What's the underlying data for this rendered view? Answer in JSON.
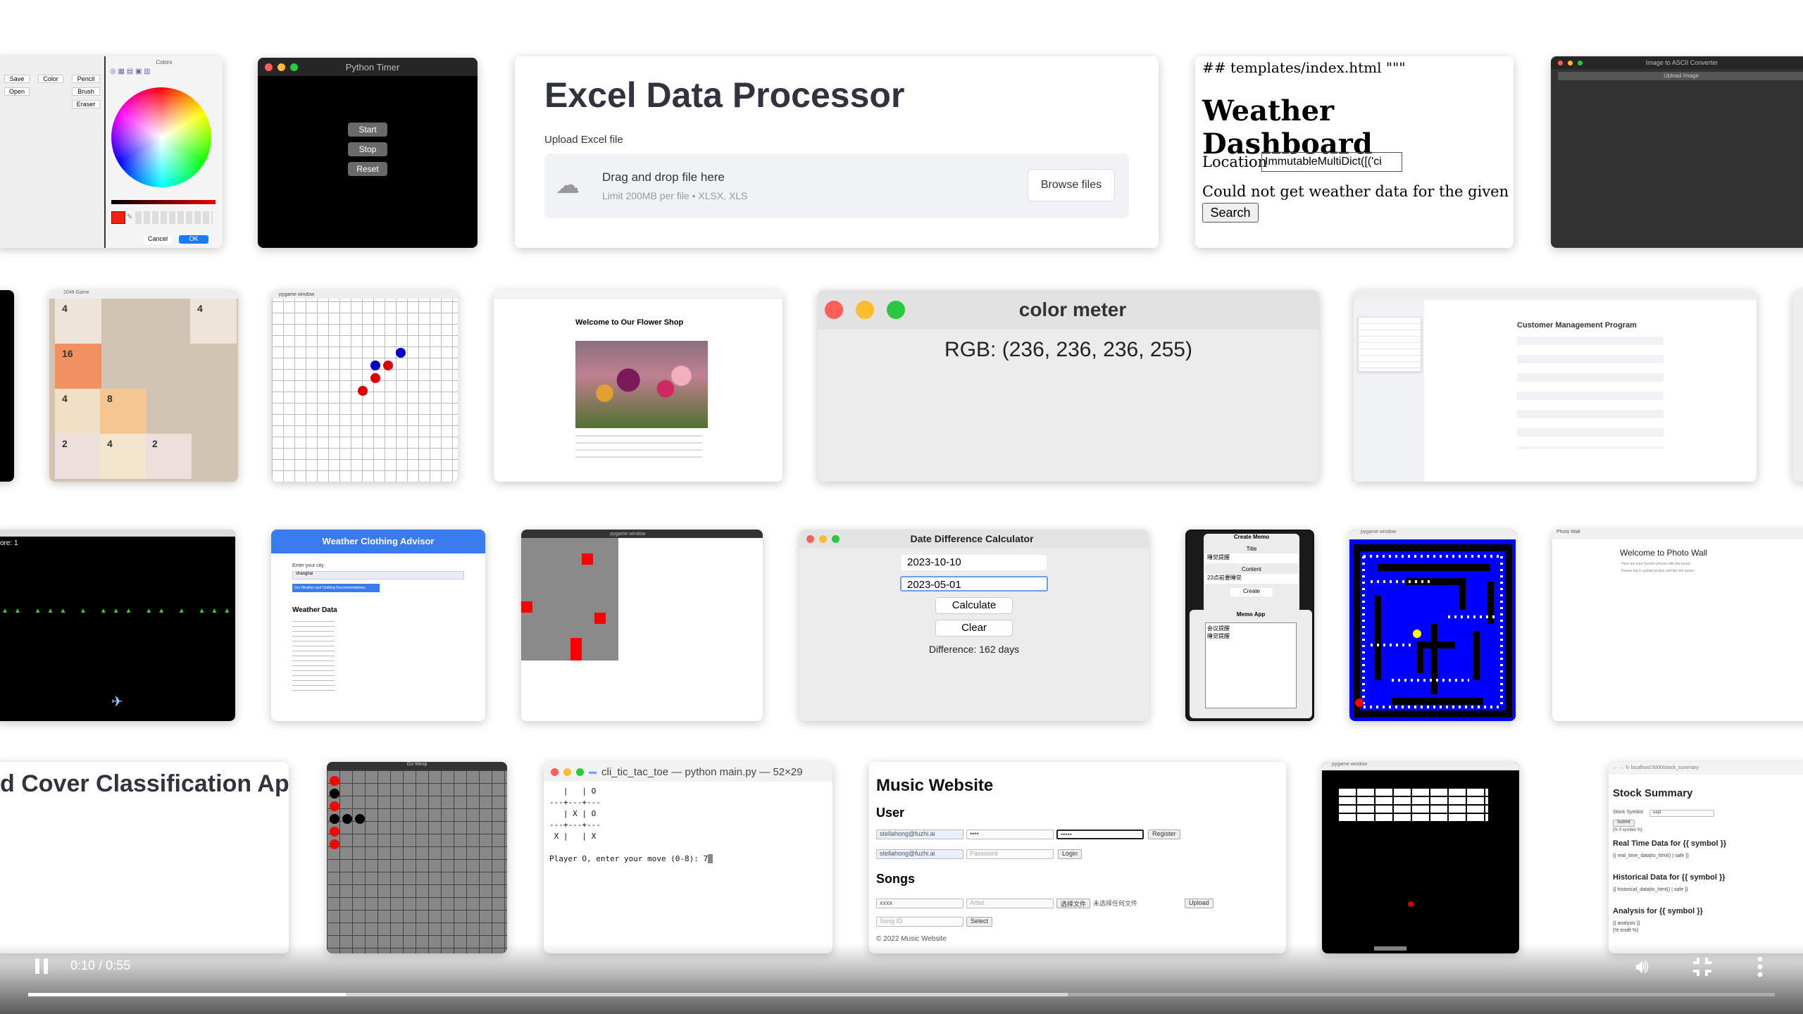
{
  "colors_app": {
    "save": "Save",
    "color": "Color",
    "pencil": "Pencil",
    "open": "Open",
    "brush": "Brush",
    "eraser": "Eraser",
    "dialog_title": "Colors",
    "cancel": "Cancel",
    "ok": "OK"
  },
  "timer_app": {
    "title": "Python Timer",
    "start": "Start",
    "stop": "Stop",
    "reset": "Reset"
  },
  "excel_app": {
    "title": "Excel Data Processor",
    "upload_label": "Upload Excel file",
    "drag_text": "Drag and drop file here",
    "limit_text": "Limit 200MB per file • XLSX, XLS",
    "browse_button": "Browse files"
  },
  "weather_app": {
    "header_comment": "## templates/index.html \"\"\"",
    "title": "Weather Dashboard",
    "location_label": "Location",
    "location_value": "ImmutableMultiDict([('ci",
    "message": "Could not get weather data for the given location.",
    "search_button": "Search"
  },
  "ascii_app": {
    "title": "Image to ASCII Converter",
    "upload_button": "Upload Image"
  },
  "game2048": {
    "cells": [
      "4",
      "4",
      "16",
      "4",
      "8",
      "2",
      "4",
      "2"
    ]
  },
  "pygame_grid": {
    "title": "pygame window"
  },
  "flower_shop": {
    "heading": "Welcome to Our Flower Shop"
  },
  "color_meter": {
    "title": "color meter",
    "rgb_text": "RGB: (236, 236, 236, 255)"
  },
  "customer_app": {
    "title": "Customer Management Program"
  },
  "space_game": {
    "score": "ore: 1"
  },
  "clothing_app": {
    "title": "Weather Clothing Advisor",
    "city_label": "Enter your city",
    "city_value": "shanghai",
    "get_button": "Get Weather and Clothing Recommendations",
    "weather_heading": "Weather Data"
  },
  "pygame_red": {
    "title": "pygame window"
  },
  "date_calc": {
    "title": "Date Difference Calculator",
    "date1": "2023-10-10",
    "date2": "2023-05-01",
    "calculate": "Calculate",
    "clear": "Clear",
    "result": "Difference: 162 days"
  },
  "memo_app": {
    "create_title": "Create Memo",
    "title_label": "Title",
    "title_value": "睡觉提醒",
    "content_label": "Content",
    "content_value": "23点前要睡觉",
    "create_button": "Create",
    "list_title": "Memo App",
    "list_items": [
      "会议提醒",
      "睡觉提醒"
    ]
  },
  "pacman": {
    "title": "pygame window"
  },
  "photo_wall": {
    "tab": "Photo Wall",
    "heading": "Welcome to Photo Wall",
    "sub1": "Here are your favorite photos with the tunes!",
    "sub2": "Please log in upload photos and like the tunes!"
  },
  "cover_app": {
    "title_partial": "d Cover Classification App"
  },
  "go_game": {
    "title": "Go Weiqi"
  },
  "terminal": {
    "title": "cli_tic_tac_toe — python main.py — 52×29",
    "board": [
      "   |   | O",
      "---+---+---",
      "   | X | O",
      "---+---+---",
      " X |   | X"
    ],
    "prompt": "Player O, enter your move (0-8): 7"
  },
  "music_app": {
    "title": "Music Website",
    "user_heading": "User",
    "email1": "stellahong@fuzhi.ai",
    "pw1": "••••",
    "pw_confirm": "•••••",
    "register": "Register",
    "email2": "stellahong@fuzhi.ai",
    "pw2": "Password",
    "login": "Login",
    "songs_heading": "Songs",
    "song_title": "xxxx",
    "artist": "Artist",
    "choose_file": "选择文件",
    "no_file": "未选择任何文件",
    "upload": "Upload",
    "song_id": "Song ID",
    "select": "Select",
    "footer": "© 2022 Music Website"
  },
  "pygame_table": {
    "title": "pygame window"
  },
  "stock_app": {
    "url": "localhost:5000/stock_summary",
    "title": "Stock Summary",
    "symbol_label": "Stock Symbol",
    "symbol_value": "aapl",
    "submit": "Submit",
    "symbol_pct": "{% if symbol %}",
    "realtime": "Real Time Data for {{ symbol }}",
    "realtime_sub": "{{ real_time_data|to_html() | safe }}",
    "historical": "Historical Data for {{ symbol }}",
    "historical_sub": "{{ historical_data|to_html() | safe }}",
    "analysis": "Analysis for {{ symbol }}",
    "analysis_sub": "{{ analysis }}",
    "endif": "{% endif %}"
  },
  "player": {
    "current_time": "0:10",
    "separator": "/",
    "duration": "0:55",
    "progress": 0.182,
    "buffered": 0.595
  }
}
